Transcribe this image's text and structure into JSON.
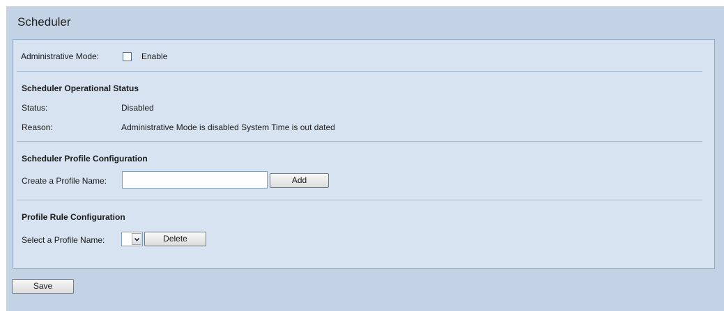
{
  "page": {
    "title": "Scheduler"
  },
  "admin_mode": {
    "label": "Administrative Mode:",
    "checkbox_label": "Enable",
    "checked": false
  },
  "operational_status": {
    "heading": "Scheduler Operational Status",
    "status_label": "Status:",
    "status_value": "Disabled",
    "reason_label": "Reason:",
    "reason_value": "Administrative Mode is disabled System Time is out dated"
  },
  "profile_config": {
    "heading": "Scheduler Profile Configuration",
    "name_label": "Create a Profile Name:",
    "name_value": "",
    "add_label": "Add"
  },
  "rule_config": {
    "heading": "Profile Rule Configuration",
    "select_label": "Select a Profile Name:",
    "selected_value": "",
    "delete_label": "Delete"
  },
  "footer": {
    "save_label": "Save"
  },
  "icons": {
    "dropdown": "chevron-down-icon"
  }
}
